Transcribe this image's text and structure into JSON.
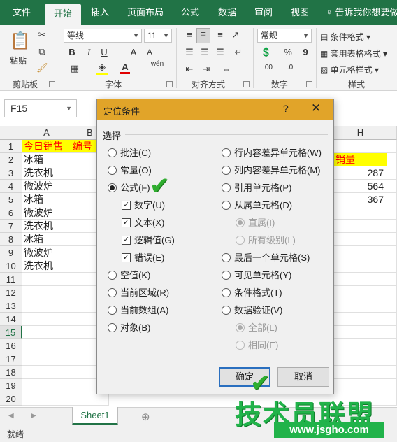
{
  "ribbon": {
    "tabs": [
      "文件",
      "开始",
      "插入",
      "页面布局",
      "公式",
      "数据",
      "审阅",
      "视图"
    ],
    "active_tab": "开始",
    "tell_me": "告诉我你想要做",
    "groups": {
      "clipboard": {
        "label": "剪贴板",
        "paste": "粘贴"
      },
      "font": {
        "label": "字体",
        "font_name": "等线",
        "font_size": "11",
        "bold": "B",
        "italic": "I",
        "underline": "U",
        "grow": "A",
        "shrink": "A",
        "wen": "wén"
      },
      "alignment": {
        "label": "对齐方式"
      },
      "number": {
        "label": "数字",
        "format": "常规",
        "percent": "%",
        "comma": "9"
      },
      "styles": {
        "label": "样式",
        "conditional": "条件格式",
        "table": "套用表格格式",
        "cell": "单元格样式"
      }
    }
  },
  "namebox": {
    "value": "F15"
  },
  "grid": {
    "columns": [
      "A",
      "B",
      "H"
    ],
    "rows": [
      "1",
      "2",
      "3",
      "4",
      "5",
      "6",
      "7",
      "8",
      "9",
      "10",
      "11",
      "12",
      "13",
      "14",
      "15",
      "16",
      "17",
      "18",
      "19",
      "20"
    ],
    "selected_row": "15",
    "colA": [
      "今日销售",
      "冰箱",
      "洗衣机",
      "微波炉",
      "冰箱",
      "微波炉",
      "洗衣机",
      "冰箱",
      "微波炉",
      "洗衣机"
    ],
    "colB_header": "编号",
    "colH": {
      "header": "销量",
      "values": [
        "287",
        "564",
        "367"
      ]
    }
  },
  "sheets": {
    "tab": "Sheet1",
    "add": "⊕"
  },
  "status": {
    "text": "就绪"
  },
  "dialog": {
    "title": "定位条件",
    "help": "?",
    "close": "✕",
    "section": "选择",
    "left_options": [
      {
        "label": "批注(C)",
        "type": "radio",
        "checked": false
      },
      {
        "label": "常量(O)",
        "type": "radio",
        "checked": false
      },
      {
        "label": "公式(F)",
        "type": "radio",
        "checked": true
      },
      {
        "label": "数字(U)",
        "type": "check",
        "checked": true
      },
      {
        "label": "文本(X)",
        "type": "check",
        "checked": true
      },
      {
        "label": "逻辑值(G)",
        "type": "check",
        "checked": true
      },
      {
        "label": "错误(E)",
        "type": "check",
        "checked": true
      },
      {
        "label": "空值(K)",
        "type": "radio",
        "checked": false
      },
      {
        "label": "当前区域(R)",
        "type": "radio",
        "checked": false
      },
      {
        "label": "当前数组(A)",
        "type": "radio",
        "checked": false
      },
      {
        "label": "对象(B)",
        "type": "radio",
        "checked": false
      }
    ],
    "right_options": [
      {
        "label": "行内容差异单元格(W)",
        "enabled": true,
        "checked": false
      },
      {
        "label": "列内容差异单元格(M)",
        "enabled": true,
        "checked": false
      },
      {
        "label": "引用单元格(P)",
        "enabled": true,
        "checked": false
      },
      {
        "label": "从属单元格(D)",
        "enabled": true,
        "checked": false
      },
      {
        "label": "直属(I)",
        "enabled": false,
        "checked": true
      },
      {
        "label": "所有级别(L)",
        "enabled": false,
        "checked": false
      },
      {
        "label": "最后一个单元格(S)",
        "enabled": true,
        "checked": false
      },
      {
        "label": "可见单元格(Y)",
        "enabled": true,
        "checked": false
      },
      {
        "label": "条件格式(T)",
        "enabled": true,
        "checked": false
      },
      {
        "label": "数据验证(V)",
        "enabled": true,
        "checked": false
      },
      {
        "label": "全部(L)",
        "enabled": false,
        "checked": true
      },
      {
        "label": "相同(E)",
        "enabled": false,
        "checked": false
      }
    ],
    "ok": "确定",
    "cancel": "取消"
  },
  "watermark": {
    "main": "技术员联盟",
    "url": "www.jsgho.com"
  },
  "colors": {
    "excel_green": "#217346",
    "dialog_title": "#e1a429",
    "highlight_yellow": "#ffff00",
    "highlight_text": "#ff0000"
  }
}
